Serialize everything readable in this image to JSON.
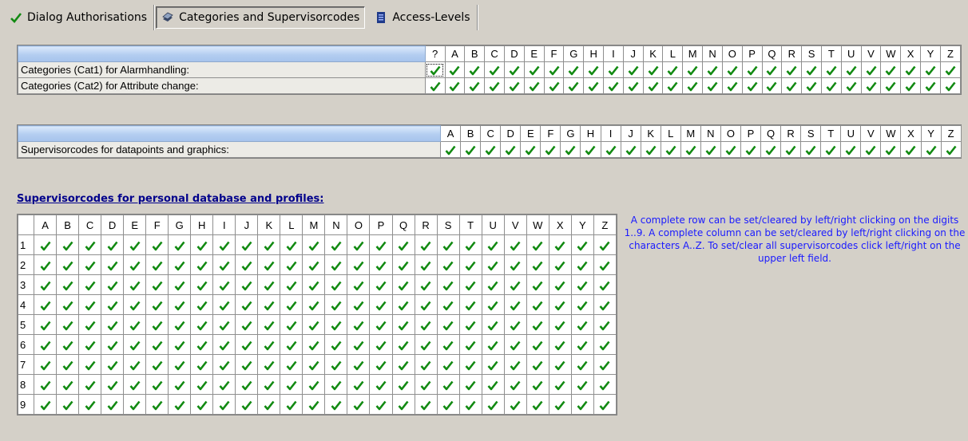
{
  "tabs": [
    {
      "label": "Dialog Authorisations",
      "icon": "checkmark-icon",
      "active": false
    },
    {
      "label": "Categories and Supervisorcodes",
      "icon": "books-icon",
      "active": true
    },
    {
      "label": "Access-Levels",
      "icon": "document-icon",
      "active": false
    }
  ],
  "categories": {
    "columns": [
      "?",
      "A",
      "B",
      "C",
      "D",
      "E",
      "F",
      "G",
      "H",
      "I",
      "J",
      "K",
      "L",
      "M",
      "N",
      "O",
      "P",
      "Q",
      "R",
      "S",
      "T",
      "U",
      "V",
      "W",
      "X",
      "Y",
      "Z"
    ],
    "rows": [
      {
        "label": "Categories (Cat1) for Alarmhandling:"
      },
      {
        "label": "Categories (Cat2) for Attribute change:"
      }
    ]
  },
  "supervisor": {
    "columns": [
      "A",
      "B",
      "C",
      "D",
      "E",
      "F",
      "G",
      "H",
      "I",
      "J",
      "K",
      "L",
      "M",
      "N",
      "O",
      "P",
      "Q",
      "R",
      "S",
      "T",
      "U",
      "V",
      "W",
      "X",
      "Y",
      "Z"
    ],
    "rows": [
      {
        "label": "Supervisorcodes for datapoints and graphics:"
      }
    ]
  },
  "personal": {
    "title": "Supervisorcodes for personal database and profiles:",
    "columns": [
      "A",
      "B",
      "C",
      "D",
      "E",
      "F",
      "G",
      "H",
      "I",
      "J",
      "K",
      "L",
      "M",
      "N",
      "O",
      "P",
      "Q",
      "R",
      "S",
      "T",
      "U",
      "V",
      "W",
      "X",
      "Y",
      "Z"
    ],
    "rows": [
      "1",
      "2",
      "3",
      "4",
      "5",
      "6",
      "7",
      "8",
      "9"
    ]
  },
  "help_text": "A complete row can be set/cleared by left/right clicking on the digits 1..9.  A complete column can be set/cleared by left/right clicking on the characters A..Z. To set/clear all supervisorcodes click left/right on the upper left field.",
  "colors": {
    "check": "#128a12",
    "help": "#1a1aff",
    "header_blue": "#b3cdf0"
  }
}
